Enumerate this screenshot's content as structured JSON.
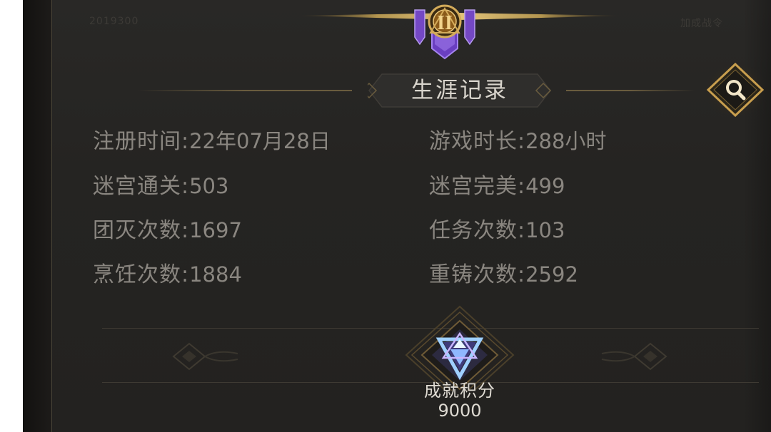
{
  "header": {
    "title": "生涯记录",
    "rank_numeral": "II",
    "faint_left": "2019300",
    "faint_right": "加成战令"
  },
  "stats": {
    "left": [
      {
        "label": "注册时间:",
        "value": "22年07月28日"
      },
      {
        "label": "迷宫通关:",
        "value": "503"
      },
      {
        "label": "团灭次数:",
        "value": "1697"
      },
      {
        "label": "烹饪次数:",
        "value": "1884"
      }
    ],
    "right": [
      {
        "label": "游戏时长:",
        "value": "288小时"
      },
      {
        "label": "迷宫完美:",
        "value": "499"
      },
      {
        "label": "任务次数:",
        "value": "103"
      },
      {
        "label": "重铸次数:",
        "value": "2592"
      }
    ]
  },
  "achievement": {
    "label": "成就积分",
    "value": "9000"
  },
  "icons": {
    "search": "magnifier-icon",
    "rank": "rank-emblem-icon",
    "achievement": "achievement-emblem-icon"
  },
  "colors": {
    "accent_gold": "#c8a65a",
    "rank_purple": "#7b52c8",
    "achievement_blue": "#6fb8ff"
  }
}
